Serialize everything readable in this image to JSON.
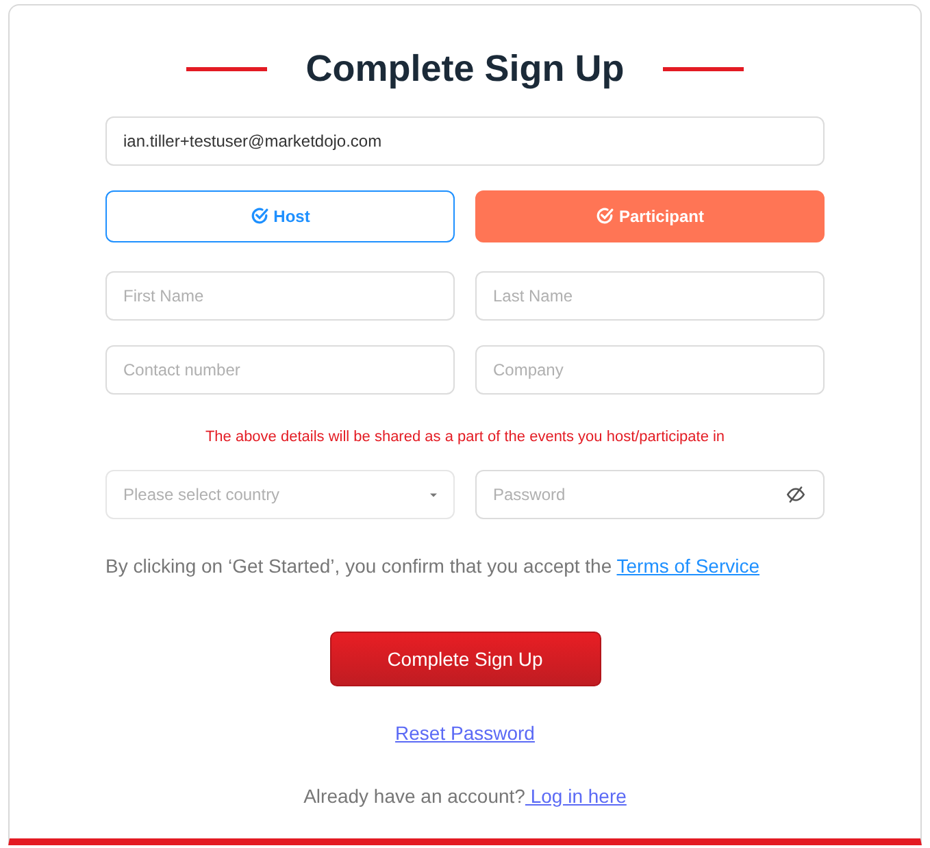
{
  "title": "Complete Sign Up",
  "email": {
    "value": "ian.tiller+testuser@marketdojo.com"
  },
  "roles": [
    {
      "label": "Host",
      "selected": false
    },
    {
      "label": "Participant",
      "selected": true
    }
  ],
  "fields": [
    {
      "kind": "text",
      "placeholder": "First Name"
    },
    {
      "kind": "text",
      "placeholder": "Last Name"
    },
    {
      "kind": "text",
      "placeholder": "Contact number"
    },
    {
      "kind": "text",
      "placeholder": "Company"
    }
  ],
  "notice": "The above details will be shared as a part of the events you host/participate in",
  "country": {
    "placeholder": "Please select country"
  },
  "password": {
    "placeholder": "Password"
  },
  "terms": {
    "text": "By clicking on ‘Get Started’, you confirm that you accept the ",
    "link": "Terms of Service"
  },
  "submit": "Complete Sign Up",
  "reset": "Reset Password",
  "login": {
    "text": "Already have an account?",
    "link": " Log in here"
  }
}
